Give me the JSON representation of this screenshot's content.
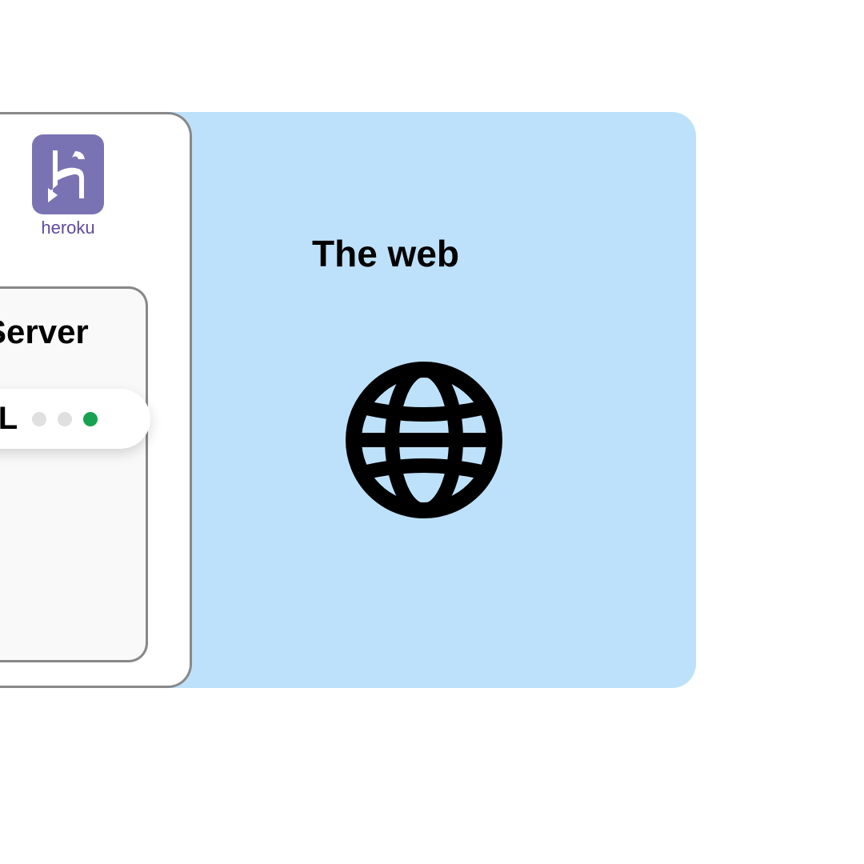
{
  "web": {
    "title": "The web"
  },
  "server": {
    "provider": "heroku",
    "label": "Server",
    "url_label": "URL"
  },
  "colors": {
    "web_background": "#bde1fa",
    "heroku_purple": "#7a73b3",
    "heroku_text": "#5c4b9e",
    "active_dot": "#15a351",
    "inactive_dot": "#e0e0e0"
  }
}
